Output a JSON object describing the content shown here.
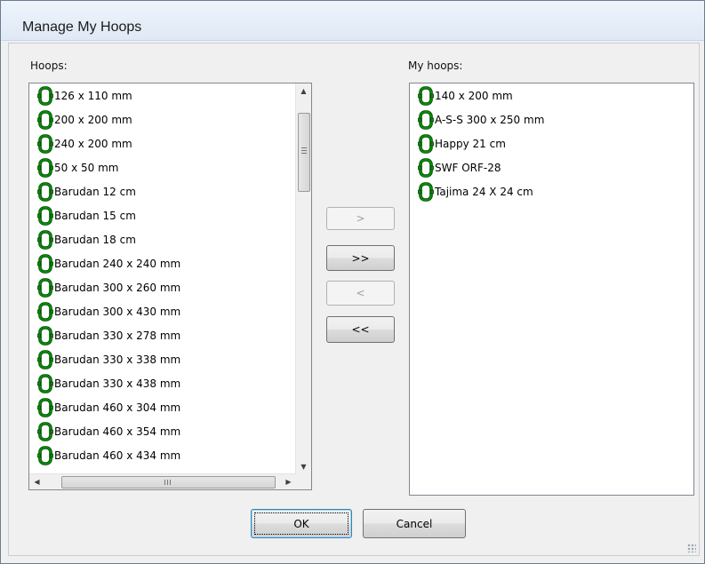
{
  "window": {
    "title": "Manage My Hoops"
  },
  "left": {
    "label": "Hoops:",
    "items": [
      "126 x 110 mm",
      "200 x 200 mm",
      "240 x 200 mm",
      "50 x 50 mm",
      "Barudan 12 cm",
      "Barudan 15 cm",
      "Barudan 18 cm",
      "Barudan 240 x 240 mm",
      "Barudan 300 x 260 mm",
      "Barudan 300 x 430 mm",
      "Barudan 330 x 278 mm",
      "Barudan 330 x 338 mm",
      "Barudan 330 x 438 mm",
      "Barudan 460 x 304 mm",
      "Barudan 460 x 354 mm",
      "Barudan 460 x 434 mm"
    ],
    "scroll_up": "▲",
    "scroll_down": "▼",
    "scroll_left": "◀",
    "scroll_right": "▶"
  },
  "right": {
    "label": "My hoops:",
    "items": [
      "140 x 200 mm",
      "A-S-S 300 x 250 mm",
      "Happy 21 cm",
      "SWF ORF-28",
      "Tajima 24 X 24 cm"
    ]
  },
  "transfer": {
    "add": ">",
    "add_all": ">>",
    "remove": "<",
    "remove_all": "<<"
  },
  "footer": {
    "ok": "OK",
    "cancel": "Cancel"
  },
  "colors": {
    "hoop_icon": "#0a8a0a",
    "hoop_icon_dark": "#004d00"
  },
  "icons": {
    "list_item_icon": "hoop-icon"
  }
}
